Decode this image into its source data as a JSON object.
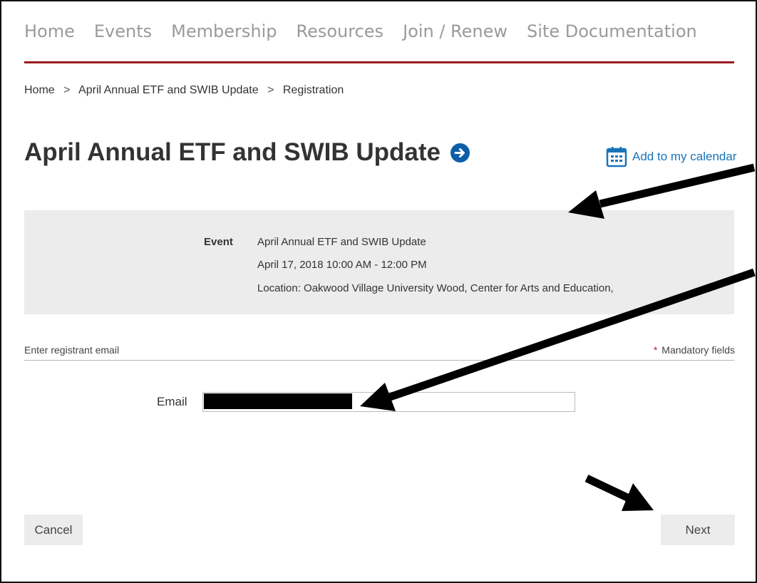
{
  "nav": {
    "items": [
      "Home",
      "Events",
      "Membership",
      "Resources",
      "Join / Renew",
      "Site Documentation"
    ]
  },
  "breadcrumb": {
    "items": [
      "Home",
      "April Annual ETF and SWIB Update",
      "Registration"
    ],
    "separator": ">"
  },
  "page": {
    "title": "April Annual ETF and SWIB Update",
    "title_icon": "arrow-right-circle-icon",
    "calendar_link": "Add to my calendar",
    "calendar_icon": "calendar-icon"
  },
  "event": {
    "label": "Event",
    "name": "April Annual ETF and SWIB Update",
    "datetime": "April 17, 2018 10:00 AM - 12:00 PM",
    "location": "Location: Oakwood Village University Wood, Center for Arts and Education,"
  },
  "form": {
    "section_label": "Enter registrant email",
    "mandatory_star": "*",
    "mandatory_label": "Mandatory fields",
    "email_label": "Email",
    "email_value": ""
  },
  "buttons": {
    "cancel": "Cancel",
    "next": "Next"
  },
  "colors": {
    "accent_rule": "#9b1b1e",
    "link_blue": "#1a73b8",
    "icon_blue": "#0d5ea8",
    "panel_gray": "#ececec",
    "mandatory_star": "#c8102e"
  }
}
